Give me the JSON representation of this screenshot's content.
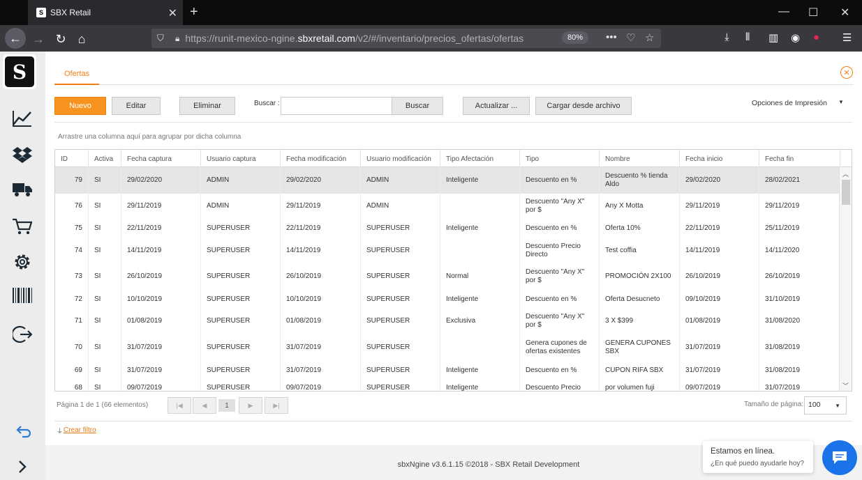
{
  "browser": {
    "tab_title": "SBX Retail",
    "favicon_text": "S",
    "url_prefix": "https://runit-mexico-ngine.",
    "url_host": "sbxretail.com",
    "url_path": "/v2/#/inventario/precios_ofertas/ofertas",
    "zoom": "80%"
  },
  "sidebar": {
    "logo_text": "S",
    "icons": [
      "chart-line-icon",
      "dropbox-icon",
      "truck-icon",
      "cart-icon",
      "gear-icon",
      "barcode-icon",
      "logout-icon"
    ],
    "bottom_icons": [
      "undo-icon",
      "chevron-right-icon"
    ]
  },
  "page": {
    "tab_label": "Ofertas"
  },
  "toolbar": {
    "nuevo": "Nuevo",
    "editar": "Editar",
    "eliminar": "Eliminar",
    "buscar_label": "Buscar :",
    "search_value": "",
    "buscar_btn": "Buscar",
    "actualizar": "Actualizar ...",
    "cargar": "Cargar desde archivo",
    "print_options": "Opciones de Impresión"
  },
  "group_hint": "Arrastre una columna aquí para agrupar por dicha columna",
  "table": {
    "columns": [
      "ID",
      "Activa",
      "Fecha captura",
      "Usuario captura",
      "Fecha modificación",
      "Usuario modificación",
      "Tipo Afectación",
      "Tipo",
      "Nombre",
      "Fecha inicio",
      "Fecha fin"
    ],
    "rows": [
      [
        "79",
        "SI",
        "29/02/2020",
        "ADMIN",
        "29/02/2020",
        "ADMIN",
        "Inteligente",
        "Descuento en %",
        "Descuento % tienda Aldo",
        "29/02/2020",
        "28/02/2021"
      ],
      [
        "76",
        "SI",
        "29/11/2019",
        "ADMIN",
        "29/11/2019",
        "ADMIN",
        "",
        "Descuento \"Any X\" por $",
        "Any X Motta",
        "29/11/2019",
        "29/11/2019"
      ],
      [
        "75",
        "SI",
        "22/11/2019",
        "SUPERUSER",
        "22/11/2019",
        "SUPERUSER",
        "Inteligente",
        "Descuento en %",
        "Oferta 10%",
        "22/11/2019",
        "25/11/2019"
      ],
      [
        "74",
        "SI",
        "14/11/2019",
        "SUPERUSER",
        "14/11/2019",
        "SUPERUSER",
        "",
        "Descuento Precio Directo",
        "Test coffia",
        "14/11/2019",
        "14/11/2020"
      ],
      [
        "73",
        "SI",
        "26/10/2019",
        "SUPERUSER",
        "26/10/2019",
        "SUPERUSER",
        "Normal",
        "Descuento \"Any X\" por $",
        "PROMOCIÓN 2X100",
        "26/10/2019",
        "26/10/2019"
      ],
      [
        "72",
        "SI",
        "10/10/2019",
        "SUPERUSER",
        "10/10/2019",
        "SUPERUSER",
        "Inteligente",
        "Descuento en %",
        "Oferta Desucneto",
        "09/10/2019",
        "31/10/2019"
      ],
      [
        "71",
        "SI",
        "01/08/2019",
        "SUPERUSER",
        "01/08/2019",
        "SUPERUSER",
        "Exclusiva",
        "Descuento \"Any X\" por $",
        "3 X $399",
        "01/08/2019",
        "31/08/2020"
      ],
      [
        "70",
        "SI",
        "31/07/2019",
        "SUPERUSER",
        "31/07/2019",
        "SUPERUSER",
        "",
        "Genera cupones de ofertas existentes",
        "GENERA CUPONES SBX",
        "31/07/2019",
        "31/08/2019"
      ],
      [
        "69",
        "SI",
        "31/07/2019",
        "SUPERUSER",
        "31/07/2019",
        "SUPERUSER",
        "Inteligente",
        "Descuento en %",
        "CUPON RIFA SBX",
        "31/07/2019",
        "31/08/2019"
      ],
      [
        "68",
        "SI",
        "09/07/2019",
        "SUPERUSER",
        "09/07/2019",
        "SUPERUSER",
        "Inteligente",
        "Descuento Precio",
        "por volumen fuji",
        "09/07/2019",
        "31/07/2019"
      ]
    ]
  },
  "pager": {
    "summary": "Página 1 de 1 (66 elementos)",
    "current_page": "1",
    "page_size_label": "Tamaño de página:",
    "page_size": "100"
  },
  "filter_link": "Crear filtro",
  "footer": "sbxNgine v3.6.1.15 ©2018 - SBX Retail Development",
  "chat": {
    "title": "Estamos en línea.",
    "subtitle": "¿En qué puedo ayudarle hoy?"
  }
}
